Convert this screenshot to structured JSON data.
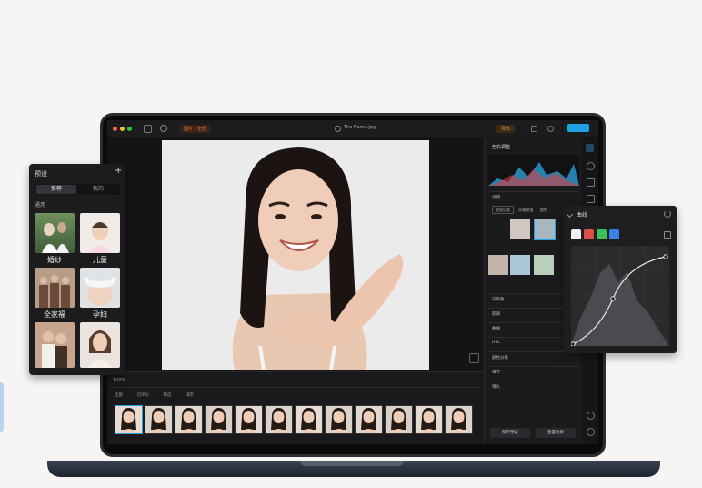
{
  "app": {
    "project_chip": "图片 · 全部",
    "file_name": "The Name.jpg",
    "export_label": "导出",
    "nav_icons": [
      "back-icon",
      "search-icon"
    ]
  },
  "presets": {
    "title": "预设",
    "add": "+",
    "tabs": [
      "推荐",
      "我的"
    ],
    "section": "通用",
    "items": [
      {
        "label": "婚纱"
      },
      {
        "label": "儿童"
      },
      {
        "label": "全家福"
      },
      {
        "label": "孕妇"
      },
      {
        "label": ""
      },
      {
        "label": ""
      }
    ]
  },
  "right_panel": {
    "title": "色彩调整",
    "sections": [
      "滤镜",
      "白平衡",
      "影调",
      "曲线",
      "HSL",
      "颜色分级",
      "细节",
      "镜头"
    ],
    "filter_tabs": [
      "滤镜分类",
      "风格滤镜",
      "我的"
    ],
    "buttons": [
      "保存预设",
      "重置效果"
    ]
  },
  "filmstrip": {
    "zoom": "100%",
    "tools": [
      "全部",
      "已评分",
      "筛选",
      "排序"
    ],
    "count": 12
  },
  "curves": {
    "title": "曲线",
    "channels": [
      {
        "name": "white-channel",
        "color": "#f0f0f0"
      },
      {
        "name": "red-channel",
        "color": "#e04b4b"
      },
      {
        "name": "green-channel",
        "color": "#3fbf5a"
      },
      {
        "name": "blue-channel",
        "color": "#3b82e6"
      }
    ]
  },
  "colors": {
    "accent": "#1fa3e6",
    "warning": "#e8773a"
  }
}
